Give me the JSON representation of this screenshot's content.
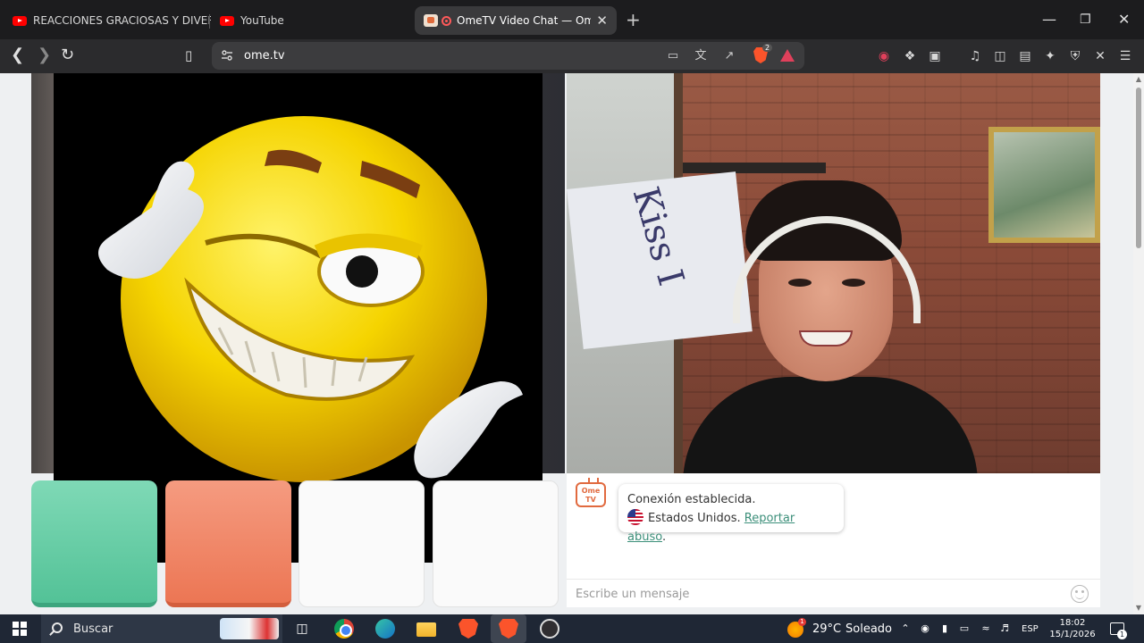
{
  "browser": {
    "tabs": [
      {
        "title": "REACCIONES GRACIOSAS Y DIVERTID",
        "icon": "youtube-icon"
      },
      {
        "title": "YouTube",
        "icon": "youtube-icon"
      },
      {
        "title": "OmeTV Video Chat — Omegl",
        "icon": "ometv-favicon",
        "active": true
      }
    ],
    "new_tab": "+",
    "window_controls": {
      "minimize": "—",
      "maximize": "❐",
      "close": "✕"
    },
    "address": "ome.tv",
    "brave_shield_count": "2"
  },
  "chat": {
    "logo_text": "Ome TV",
    "connection_status": "Conexión establecida.",
    "country": "Estados Unidos.",
    "report_link": "Reportar abuso",
    "report_suffix": ".",
    "input_placeholder": "Escribe un mensaje"
  },
  "remote_video": {
    "sign_text": "Kiss I"
  },
  "taskbar": {
    "search_label": "Buscar",
    "weather_badge": "1",
    "temperature": "29°C",
    "condition": "Soleado",
    "language": "ESP",
    "time": "18:02",
    "date": "15/1/2026",
    "notification_count": "1"
  },
  "colors": {
    "accent_green": "#53c297",
    "accent_orange": "#ec7654",
    "link": "#3c8f7a",
    "tabstrip_bg": "#1c1c1e",
    "taskbar_bg": "#1f2735"
  }
}
